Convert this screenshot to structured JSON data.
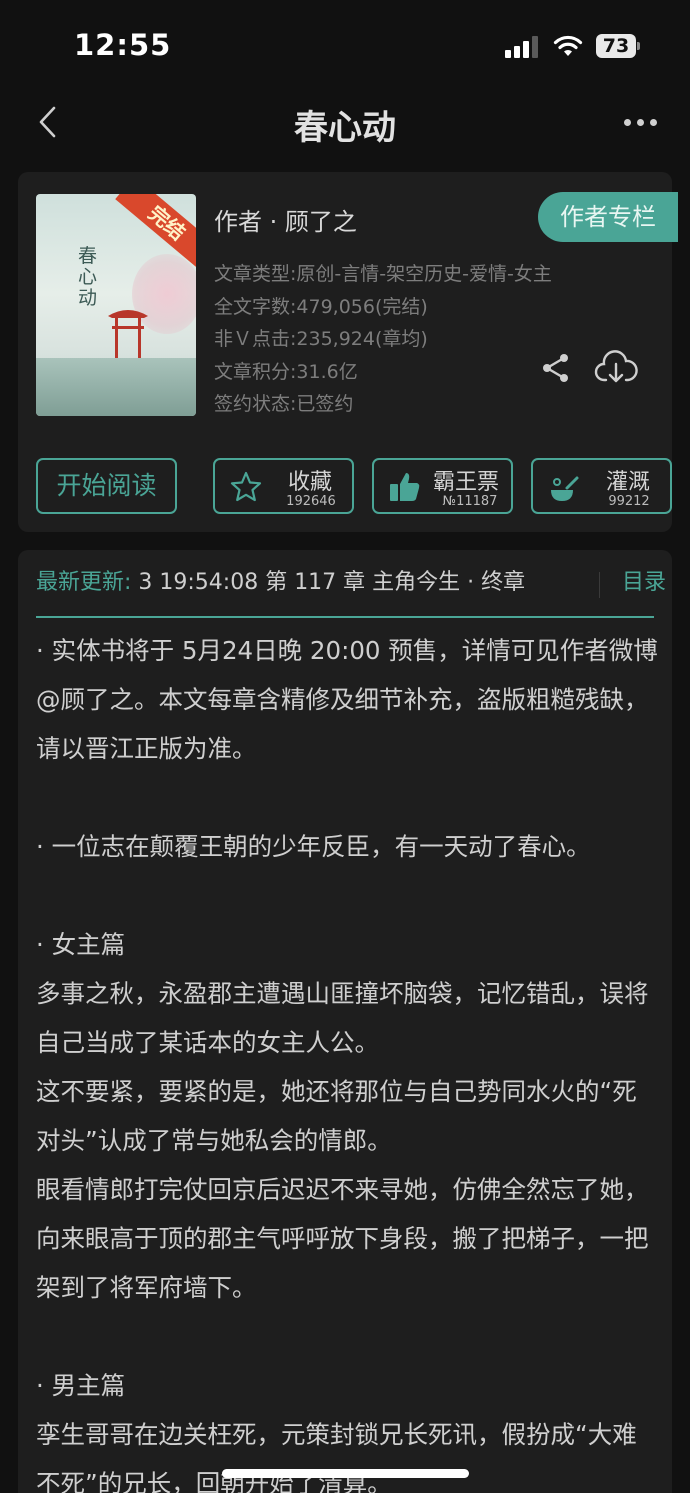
{
  "status_bar": {
    "time": "12:55",
    "battery": "73"
  },
  "nav": {
    "title": "春心动"
  },
  "book": {
    "cover_badge": "完结",
    "cover_title": "春心动",
    "author": "作者 · 顾了之",
    "author_column_button": "作者专栏",
    "meta": [
      "文章类型:原创-言情-架空历史-爱情-女主",
      "全文字数:479,056(完结)",
      "非Ｖ点击:235,924(章均)",
      "文章积分:31.6亿",
      "签约状态:已签约"
    ],
    "actions": {
      "read": "开始阅读",
      "favorite": {
        "label": "收藏",
        "count": "192646"
      },
      "ticket": {
        "label": "霸王票",
        "count": "№11187"
      },
      "water": {
        "label": "灌溉",
        "count": "99212"
      }
    }
  },
  "latest_update": {
    "label": "最新更新: ",
    "text": "3 19:54:08   第 117 章  主角今生 · 终章",
    "toc": "目录"
  },
  "description": [
    "· 实体书将于 5月24日晚 20:00 预售，详情可见作者微博 @顾了之。本文每章含精修及细节补充，盗版粗糙残缺，请以晋江正版为准。",
    "",
    "· 一位志在颠覆王朝的少年反臣，有一天动了春心。",
    "",
    "· 女主篇",
    "多事之秋，永盈郡主遭遇山匪撞坏脑袋，记忆错乱，误将自己当成了某话本的女主人公。",
    "这不要紧，要紧的是，她还将那位与自己势同水火的“死对头”认成了常与她私会的情郎。",
    "眼看情郎打完仗回京后迟迟不来寻她，仿佛全然忘了她，向来眼高于顶的郡主气呼呼放下身段，搬了把梯子，一把架到了将军府墙下。",
    "",
    "· 男主篇",
    "孪生哥哥在边关枉死，元策封锁兄长死讯，假扮成“大难不死”的兄长，回朝开始了清算。"
  ]
}
